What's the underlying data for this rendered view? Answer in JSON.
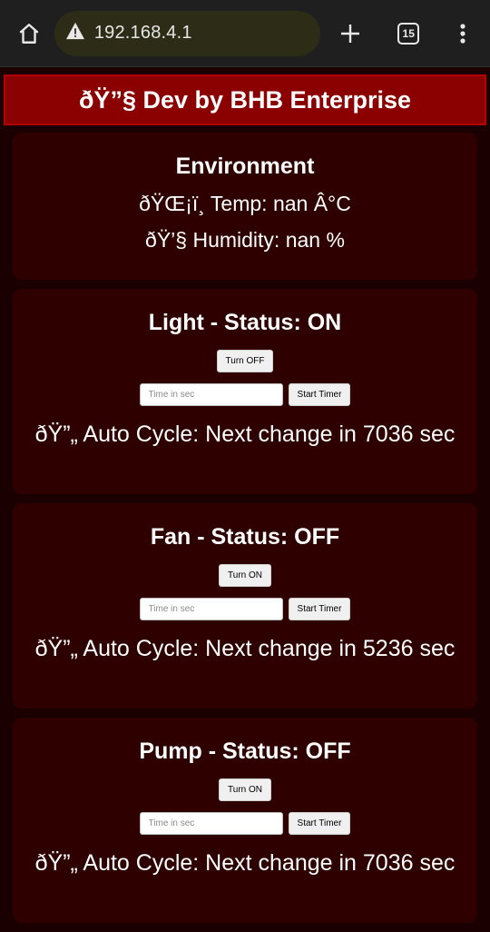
{
  "browser": {
    "url": "192.168.4.1",
    "tab_count": "15"
  },
  "header": {
    "title": "ðŸ”§ Dev by BHB Enterprise"
  },
  "environment": {
    "title": "Environment",
    "temp": "ðŸŒ¡ï¸ Temp: nan Â°C",
    "humidity": "ðŸ’§ Humidity: nan %"
  },
  "devices": [
    {
      "title": "Light - Status: ON",
      "toggle_label": "Turn OFF",
      "timer_placeholder": "Time in sec",
      "timer_button": "Start Timer",
      "cycle_text": "ðŸ”„ Auto Cycle: Next change in 7036 sec"
    },
    {
      "title": "Fan - Status: OFF",
      "toggle_label": "Turn ON",
      "timer_placeholder": "Time in sec",
      "timer_button": "Start Timer",
      "cycle_text": "ðŸ”„ Auto Cycle: Next change in 5236 sec"
    },
    {
      "title": "Pump - Status: OFF",
      "toggle_label": "Turn ON",
      "timer_placeholder": "Time in sec",
      "timer_button": "Start Timer",
      "cycle_text": "ðŸ”„ Auto Cycle: Next change in 7036 sec"
    }
  ],
  "colors": {
    "background": "#1a0000",
    "card": "#2e0000",
    "header": "#8b0000"
  }
}
